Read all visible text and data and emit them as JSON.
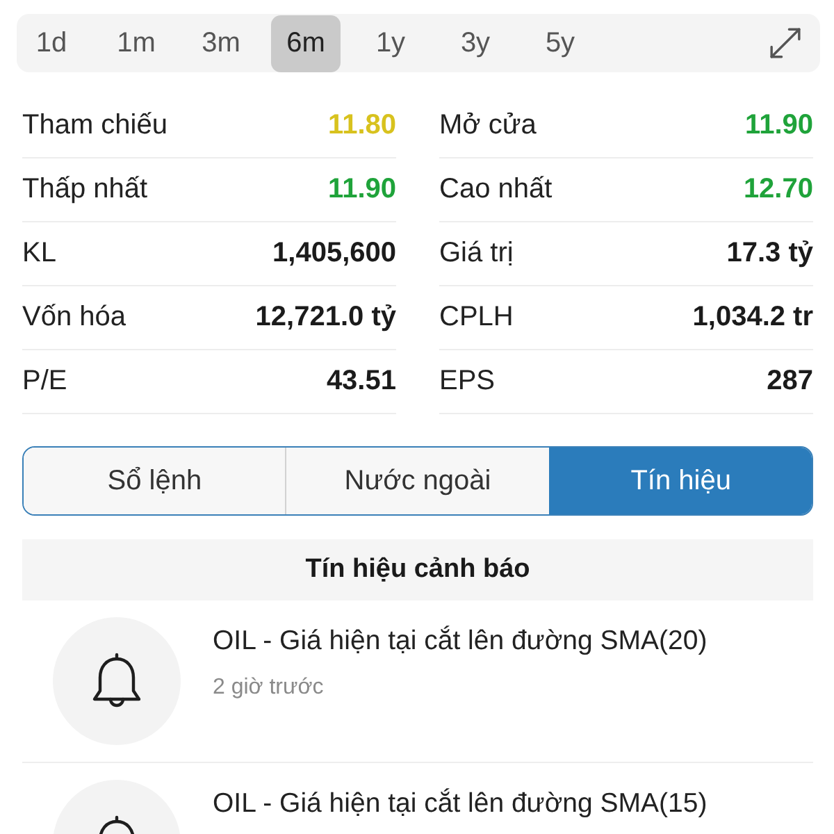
{
  "range_tabs": [
    {
      "label": "1d",
      "selected": false
    },
    {
      "label": "1m",
      "selected": false
    },
    {
      "label": "3m",
      "selected": false
    },
    {
      "label": "6m",
      "selected": true
    },
    {
      "label": "1y",
      "selected": false
    },
    {
      "label": "3y",
      "selected": false
    },
    {
      "label": "5y",
      "selected": false
    }
  ],
  "stats": [
    {
      "label": "Tham chiếu",
      "value": "11.80",
      "color": "#d8c21e"
    },
    {
      "label": "Mở cửa",
      "value": "11.90",
      "color": "#1fa33a"
    },
    {
      "label": "Thấp nhất",
      "value": "11.90",
      "color": "#1fa33a"
    },
    {
      "label": "Cao nhất",
      "value": "12.70",
      "color": "#1fa33a"
    },
    {
      "label": "KL",
      "value": "1,405,600",
      "color": "#1b1b1b"
    },
    {
      "label": "Giá trị",
      "value": "17.3 tỷ",
      "color": "#1b1b1b"
    },
    {
      "label": "Vốn hóa",
      "value": "12,721.0 tỷ",
      "color": "#1b1b1b"
    },
    {
      "label": "CPLH",
      "value": "1,034.2 tr",
      "color": "#1b1b1b"
    },
    {
      "label": "P/E",
      "value": "43.51",
      "color": "#1b1b1b"
    },
    {
      "label": "EPS",
      "value": "287",
      "color": "#1b1b1b"
    }
  ],
  "data_tabs": [
    {
      "label": "Sổ lệnh",
      "selected": false
    },
    {
      "label": "Nước ngoài",
      "selected": false
    },
    {
      "label": "Tín hiệu",
      "selected": true
    }
  ],
  "signals": {
    "title": "Tín hiệu cảnh báo",
    "items": [
      {
        "text": "OIL - Giá hiện tại cắt lên đường SMA(20)",
        "time": "2 giờ trước"
      },
      {
        "text": "OIL - Giá hiện tại cắt lên đường SMA(15)"
      }
    ]
  }
}
